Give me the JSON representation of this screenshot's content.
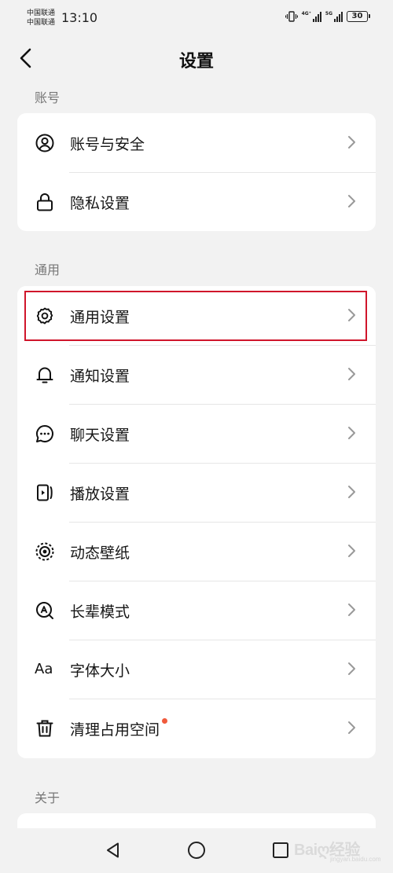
{
  "status_bar": {
    "carrier_1": "中国联通",
    "carrier_2": "中国联通",
    "time": "13:10",
    "network_1": "4G⁺",
    "network_2": "5G",
    "battery": "30"
  },
  "header": {
    "title": "设置",
    "back_icon": "chevron-left-icon"
  },
  "sections": {
    "account": {
      "label": "账号",
      "items": [
        {
          "label": "账号与安全",
          "icon": "user-circle-icon"
        },
        {
          "label": "隐私设置",
          "icon": "lock-icon"
        }
      ]
    },
    "general": {
      "label": "通用",
      "items": [
        {
          "label": "通用设置",
          "icon": "gear-icon",
          "highlighted": true
        },
        {
          "label": "通知设置",
          "icon": "bell-icon"
        },
        {
          "label": "聊天设置",
          "icon": "chat-bubble-icon"
        },
        {
          "label": "播放设置",
          "icon": "play-video-icon"
        },
        {
          "label": "动态壁纸",
          "icon": "dynamic-wallpaper-icon"
        },
        {
          "label": "长辈模式",
          "icon": "elder-mode-icon"
        },
        {
          "label": "字体大小",
          "icon": "font-size-icon",
          "icon_text": "Aa"
        },
        {
          "label": "清理占用空间",
          "icon": "trash-icon",
          "badge": "red-dot"
        }
      ]
    },
    "about": {
      "label": "关于"
    }
  },
  "nav_bar": {
    "back": "triangle-back-icon",
    "home": "circle-home-icon",
    "recent": "square-recent-icon"
  },
  "watermark": {
    "text": "Baiღ经验",
    "subtext": "jingyan.baidu.com"
  },
  "colors": {
    "background": "#f2f2f2",
    "card": "#ffffff",
    "highlight_border": "#d0152b",
    "badge_dot": "#f05a3c"
  }
}
